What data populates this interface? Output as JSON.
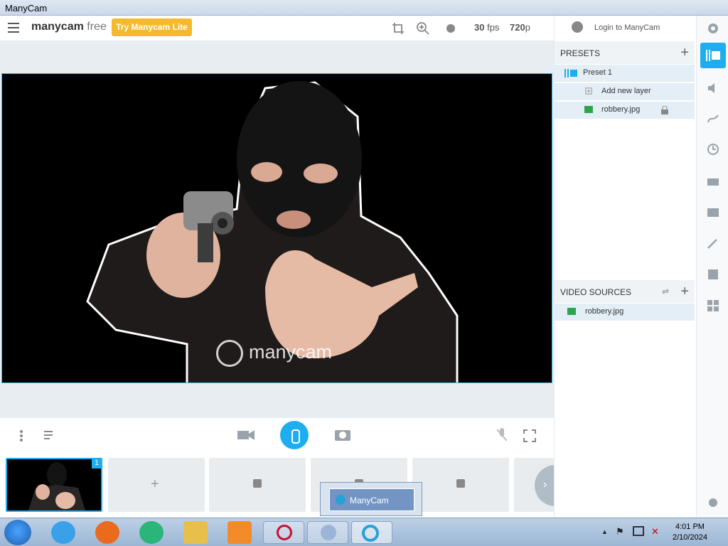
{
  "window": {
    "title": "ManyCam"
  },
  "toolbar": {
    "logo_main": "manycam",
    "logo_suffix": "free",
    "try_button": "Try Manycam Lite",
    "fps_value": "30",
    "fps_unit": "fps",
    "res_value": "720",
    "res_unit": "p"
  },
  "login": {
    "label": "Login to ManyCam"
  },
  "presets": {
    "header": "PRESETS",
    "preset_name": "Preset 1",
    "add_layer": "Add new layer",
    "layer_file": "robbery.jpg"
  },
  "video_sources": {
    "header": "VIDEO SOURCES",
    "source_file": "robbery.jpg"
  },
  "preview": {
    "watermark": "manycam"
  },
  "scenes": {
    "first_badge": "1",
    "add_label": "+"
  },
  "taskbar": {
    "popup_label": "ManyCam",
    "time": "4:01 PM",
    "date": "2/10/2024"
  },
  "colors": {
    "accent": "#1eaef0",
    "try_button": "#f5b92e"
  }
}
